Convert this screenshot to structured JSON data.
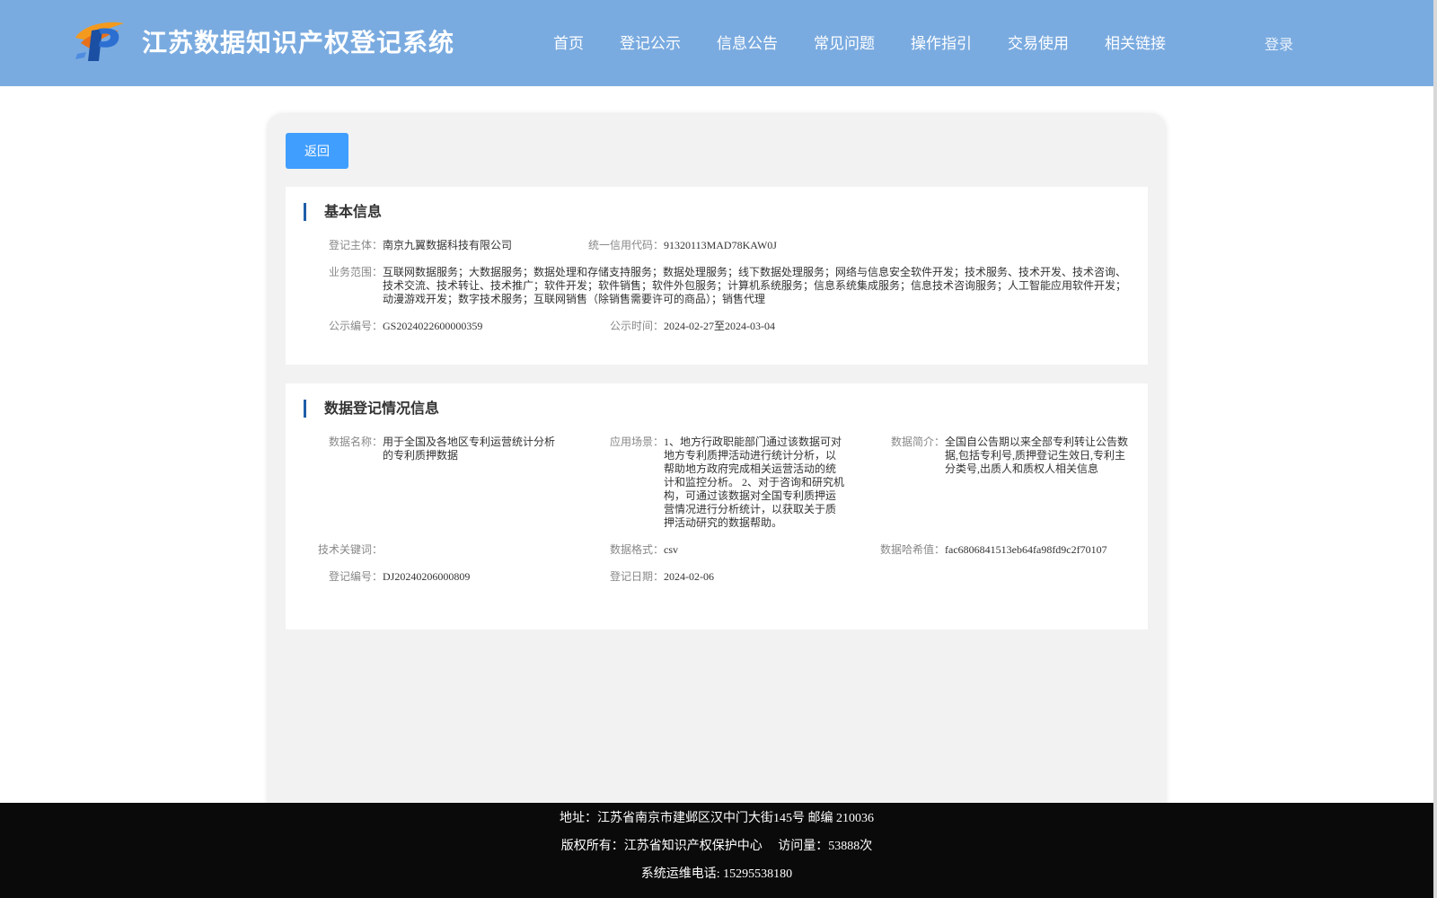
{
  "header": {
    "title": "江苏数据知识产权登记系统",
    "nav": [
      "首页",
      "登记公示",
      "信息公告",
      "常见问题",
      "操作指引",
      "交易使用",
      "相关链接"
    ],
    "login": "登录"
  },
  "actions": {
    "back": "返回"
  },
  "basic": {
    "title": "基本信息",
    "entity_label": "登记主体：",
    "entity": "南京九翼数据科技有限公司",
    "credit_label": "统一信用代码：",
    "credit": "91320113MAD78KAW0J",
    "scope_label": "业务范围：",
    "scope": "互联网数据服务；大数据服务；数据处理和存储支持服务；数据处理服务；线下数据处理服务；网络与信息安全软件开发；技术服务、技术开发、技术咨询、技术交流、技术转让、技术推广；软件开发；软件销售；软件外包服务；计算机系统服务；信息系统集成服务；信息技术咨询服务；人工智能应用软件开发；动漫游戏开发；数字技术服务；互联网销售（除销售需要许可的商品）；销售代理",
    "pub_no_label": "公示编号：",
    "pub_no": "GS2024022600000359",
    "pub_time_label": "公示时间：",
    "pub_time": "2024-02-27至2024-03-04"
  },
  "data_info": {
    "title": "数据登记情况信息",
    "name_label": "数据名称：",
    "name": "用于全国及各地区专利运营统计分析的专利质押数据",
    "scene_label": "应用场景：",
    "scene": "1、地方行政职能部门通过该数据可对地方专利质押活动进行统计分析，以帮助地方政府完成相关运营活动的统计和监控分析。 2、对于咨询和研究机构，可通过该数据对全国专利质押运营情况进行分析统计，以获取关于质押活动研究的数据帮助。",
    "intro_label": "数据简介：",
    "intro": "全国自公告期以来全部专利转让公告数据,包括专利号,质押登记生效日,专利主分类号,出质人和质权人相关信息",
    "keywords_label": "技术关键词：",
    "keywords": "",
    "format_label": "数据格式：",
    "format": "csv",
    "hash_label": "数据哈希值：",
    "hash": "fac6806841513eb64fa98fd9c2f70107",
    "reg_no_label": "登记编号：",
    "reg_no": "DJ20240206000809",
    "reg_date_label": "登记日期：",
    "reg_date": "2024-02-06"
  },
  "footer": {
    "address": "地址：江苏省南京市建邺区汉中门大街145号 邮编 210036",
    "copyright": "版权所有：江苏省知识产权保护中心　 访问量：53888次",
    "phone": "系统运维电话: 15295538180"
  }
}
